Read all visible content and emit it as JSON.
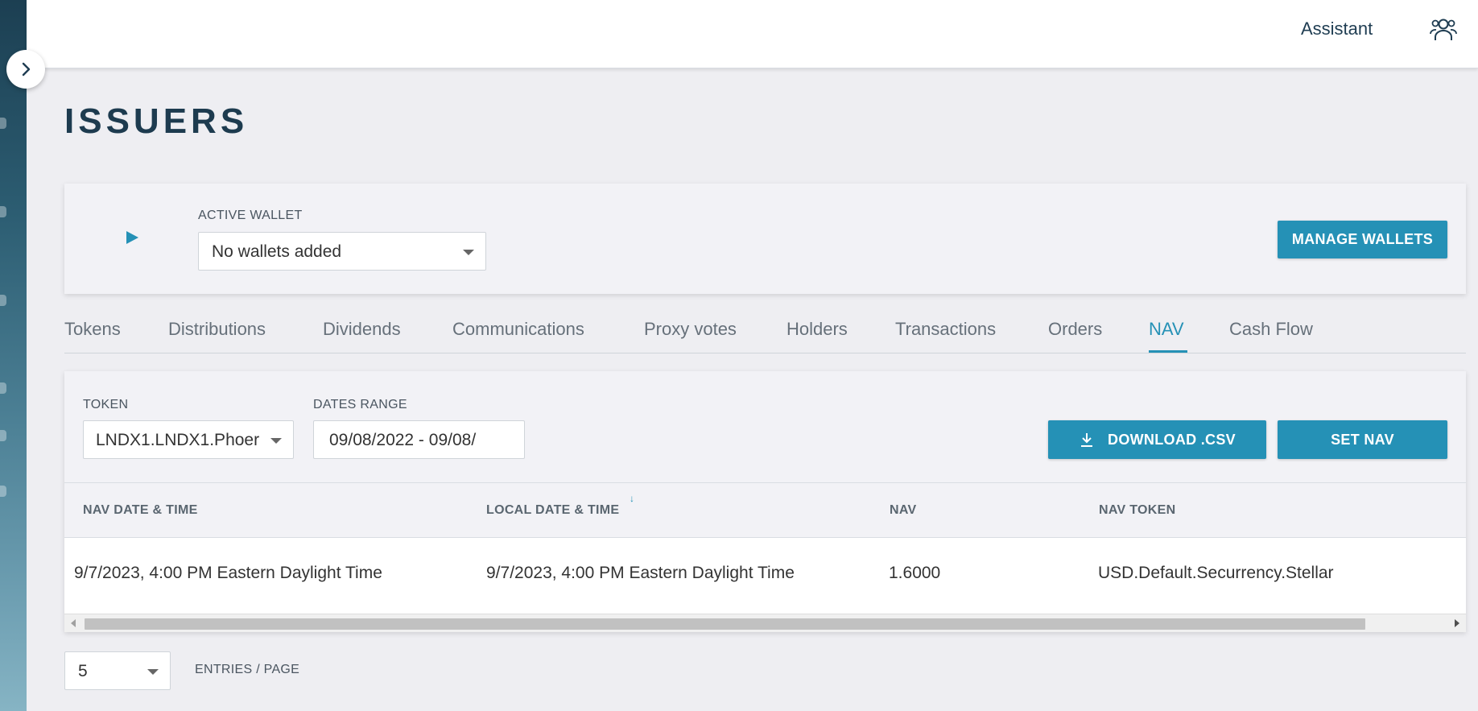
{
  "header": {
    "assistant_label": "Assistant",
    "users_icon": "users-icon"
  },
  "sidebar": {
    "toggle_icon": "chevron-right-icon"
  },
  "page": {
    "title": "ISSUERS"
  },
  "wallet": {
    "label": "ACTIVE WALLET",
    "selected": "No wallets added",
    "manage_button": "MANAGE WALLETS"
  },
  "tabs": [
    {
      "label": "Tokens"
    },
    {
      "label": "Distributions"
    },
    {
      "label": "Dividends"
    },
    {
      "label": "Communications"
    },
    {
      "label": "Proxy votes"
    },
    {
      "label": "Holders"
    },
    {
      "label": "Transactions"
    },
    {
      "label": "Orders"
    },
    {
      "label": "NAV",
      "active": true
    },
    {
      "label": "Cash Flow"
    }
  ],
  "nav": {
    "token_label": "TOKEN",
    "token_value": "LNDX1.LNDX1.Phoer",
    "dates_label": "DATES RANGE",
    "dates_value": "09/08/2022 - 09/08/",
    "download_button": "DOWNLOAD .CSV",
    "set_nav_button": "SET NAV",
    "columns": [
      "NAV DATE & TIME",
      "LOCAL DATE & TIME",
      "NAV",
      "NAV TOKEN"
    ],
    "sort_indicator": "↓",
    "rows": [
      [
        "9/7/2023, 4:00 PM Eastern Daylight Time",
        "9/7/2023, 4:00 PM Eastern Daylight Time",
        "1.6000",
        "USD.Default.Securrency.Stellar"
      ]
    ]
  },
  "pagination": {
    "page_size": "5",
    "entries_label": "ENTRIES / PAGE"
  },
  "colors": {
    "accent": "#2591b6",
    "title": "#1d3b4f",
    "background": "#eeeef2"
  }
}
